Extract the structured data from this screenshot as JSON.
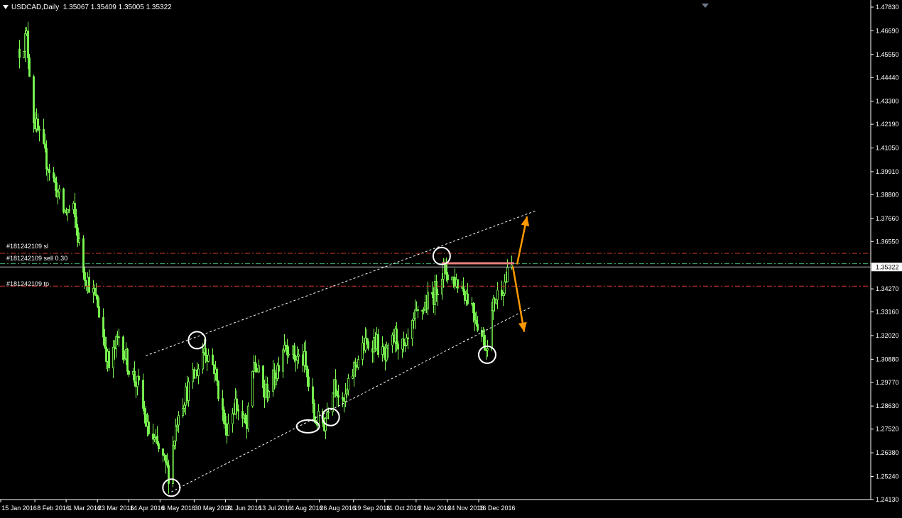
{
  "header": {
    "symbol": "USDCAD,Daily",
    "ohlc": "1.35067 1.35409 1.35005 1.35322"
  },
  "trade_lines": {
    "sl_label": "#181242109 sl",
    "entry_label": "#181242109 sell 0.30",
    "tp_label": "#181242109 tp"
  },
  "colors": {
    "background": "#000000",
    "bull_candle": "#7CFC52",
    "bear_candle": "#ffffff",
    "sl_line": "#d23b2a",
    "tp_line": "#d23b2a",
    "entry_line": "#3cb371",
    "current_price_line": "#c0c0c0",
    "resistance_line": "#f08080",
    "arrow": "#ff9900",
    "channel": "#ffffff"
  },
  "chart_data": {
    "type": "candlestick",
    "symbol": "USDCAD",
    "timeframe": "Daily",
    "ylim": [
      1.2413,
      1.4783
    ],
    "y_ticks": [
      "1.47830",
      "1.46690",
      "1.45550",
      "1.44440",
      "1.43300",
      "1.42190",
      "1.41050",
      "1.39910",
      "1.38800",
      "1.37660",
      "1.36550",
      "1.35322",
      "1.34270",
      "1.33160",
      "1.32020",
      "1.30880",
      "1.29770",
      "1.28630",
      "1.27520",
      "1.26380",
      "1.25240",
      "1.24130"
    ],
    "x_ticks": [
      "15 Jan 2016",
      "8 Feb 2016",
      "1 Mar 2016",
      "23 Mar 2016",
      "14 Apr 2016",
      "6 May 2016",
      "30 May 2016",
      "21 Jun 2016",
      "13 Jul 2016",
      "4 Aug 2016",
      "26 Aug 2016",
      "19 Sep 2016",
      "11 Oct 2016",
      "2 Nov 2016",
      "24 Nov 2016",
      "16 Dec 2016"
    ],
    "current_price": 1.35322,
    "levels": {
      "sl": 1.3598,
      "entry": 1.3548,
      "tp": 1.344
    },
    "close_anchors": [
      {
        "date": "2016-01-15",
        "close": 1.458
      },
      {
        "date": "2016-01-20",
        "close": 1.464
      },
      {
        "date": "2016-01-25",
        "close": 1.425
      },
      {
        "date": "2016-02-01",
        "close": 1.408
      },
      {
        "date": "2016-02-08",
        "close": 1.395
      },
      {
        "date": "2016-02-15",
        "close": 1.38
      },
      {
        "date": "2016-02-22",
        "close": 1.38
      },
      {
        "date": "2016-02-29",
        "close": 1.352
      },
      {
        "date": "2016-03-10",
        "close": 1.335
      },
      {
        "date": "2016-03-18",
        "close": 1.305
      },
      {
        "date": "2016-03-25",
        "close": 1.32
      },
      {
        "date": "2016-04-01",
        "close": 1.305
      },
      {
        "date": "2016-04-08",
        "close": 1.295
      },
      {
        "date": "2016-04-14",
        "close": 1.275
      },
      {
        "date": "2016-04-22",
        "close": 1.265
      },
      {
        "date": "2016-04-29",
        "close": 1.254
      },
      {
        "date": "2016-05-06",
        "close": 1.285
      },
      {
        "date": "2016-05-13",
        "close": 1.295
      },
      {
        "date": "2016-05-20",
        "close": 1.305
      },
      {
        "date": "2016-05-24",
        "close": 1.315
      },
      {
        "date": "2016-05-31",
        "close": 1.305
      },
      {
        "date": "2016-06-08",
        "close": 1.275
      },
      {
        "date": "2016-06-15",
        "close": 1.288
      },
      {
        "date": "2016-06-23",
        "close": 1.275
      },
      {
        "date": "2016-06-28",
        "close": 1.308
      },
      {
        "date": "2016-07-05",
        "close": 1.292
      },
      {
        "date": "2016-07-12",
        "close": 1.3
      },
      {
        "date": "2016-07-19",
        "close": 1.318
      },
      {
        "date": "2016-07-26",
        "close": 1.31
      },
      {
        "date": "2016-08-02",
        "close": 1.308
      },
      {
        "date": "2016-08-09",
        "close": 1.28
      },
      {
        "date": "2016-08-16",
        "close": 1.278
      },
      {
        "date": "2016-08-23",
        "close": 1.3
      },
      {
        "date": "2016-08-29",
        "close": 1.285
      },
      {
        "date": "2016-09-06",
        "close": 1.305
      },
      {
        "date": "2016-09-13",
        "close": 1.315
      },
      {
        "date": "2016-09-21",
        "close": 1.318
      },
      {
        "date": "2016-09-28",
        "close": 1.308
      },
      {
        "date": "2016-10-05",
        "close": 1.32
      },
      {
        "date": "2016-10-12",
        "close": 1.312
      },
      {
        "date": "2016-10-19",
        "close": 1.328
      },
      {
        "date": "2016-10-26",
        "close": 1.335
      },
      {
        "date": "2016-11-01",
        "close": 1.34
      },
      {
        "date": "2016-11-08",
        "close": 1.352
      },
      {
        "date": "2016-11-14",
        "close": 1.348
      },
      {
        "date": "2016-11-21",
        "close": 1.344
      },
      {
        "date": "2016-11-28",
        "close": 1.335
      },
      {
        "date": "2016-12-05",
        "close": 1.32
      },
      {
        "date": "2016-12-08",
        "close": 1.315
      },
      {
        "date": "2016-12-14",
        "close": 1.338
      },
      {
        "date": "2016-12-21",
        "close": 1.346
      },
      {
        "date": "2016-12-26",
        "close": 1.3532
      }
    ],
    "annotations": {
      "channel_upper": [
        {
          "date": "2016-04-13",
          "price": 1.3105
        },
        {
          "date": "2017-01-13",
          "price": 1.3805
        }
      ],
      "channel_lower": [
        {
          "date": "2016-05-01",
          "price": 1.245
        },
        {
          "date": "2017-01-09",
          "price": 1.334
        }
      ],
      "resistance_segment": [
        {
          "date": "2016-11-07",
          "price": 1.355
        },
        {
          "date": "2016-12-28",
          "price": 1.355
        }
      ],
      "breakout_arrow": [
        {
          "date": "2016-12-30",
          "price": 1.3545
        },
        {
          "date": "2017-01-06",
          "price": 1.3775
        }
      ],
      "breakdown_arrow": [
        {
          "date": "2016-12-27",
          "price": 1.3535
        },
        {
          "date": "2017-01-04",
          "price": 1.322
        }
      ],
      "swing_circles": [
        {
          "date": "2016-05-01",
          "price": 1.247
        },
        {
          "date": "2016-05-19",
          "price": 1.318
        },
        {
          "date": "2016-08-05",
          "price": 1.2765
        },
        {
          "date": "2016-08-21",
          "price": 1.281
        },
        {
          "date": "2016-11-07",
          "price": 1.3585
        },
        {
          "date": "2016-12-09",
          "price": 1.311
        }
      ]
    }
  }
}
